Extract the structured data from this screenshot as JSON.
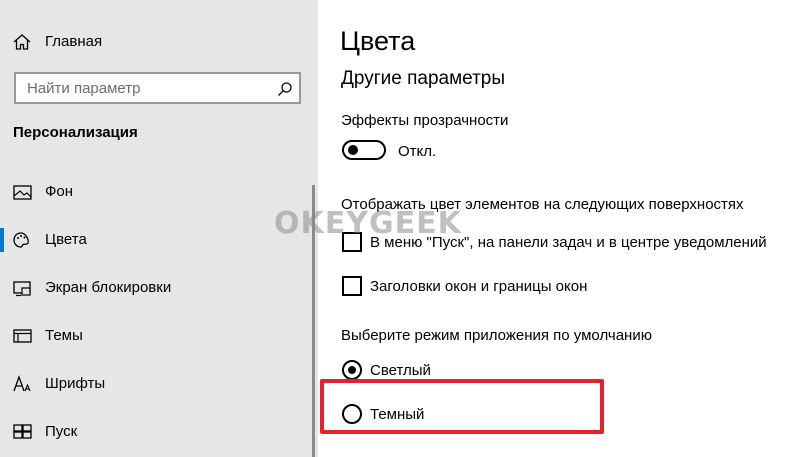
{
  "sidebar": {
    "home_label": "Главная",
    "search_placeholder": "Найти параметр",
    "section_title": "Персонализация",
    "items": [
      {
        "label": "Фон",
        "icon": "image-icon"
      },
      {
        "label": "Цвета",
        "icon": "palette-icon",
        "selected": true
      },
      {
        "label": "Экран блокировки",
        "icon": "lock-screen-icon"
      },
      {
        "label": "Темы",
        "icon": "themes-icon"
      },
      {
        "label": "Шрифты",
        "icon": "fonts-icon"
      },
      {
        "label": "Пуск",
        "icon": "start-icon"
      }
    ]
  },
  "main": {
    "title": "Цвета",
    "subtitle": "Другие параметры",
    "transparency": {
      "label": "Эффекты прозрачности",
      "state_label": "Откл.",
      "on": false
    },
    "surfaces": {
      "label": "Отображать цвет элементов на следующих поверхностях",
      "options": [
        {
          "label": "В меню \"Пуск\", на панели задач и в центре уведомлений",
          "checked": false
        },
        {
          "label": "Заголовки окон и границы окон",
          "checked": false
        }
      ]
    },
    "app_mode": {
      "label": "Выберите режим приложения по умолчанию",
      "options": [
        {
          "label": "Светлый",
          "selected": true
        },
        {
          "label": "Темный",
          "selected": false
        }
      ]
    }
  },
  "watermark": "OKEYGEEK",
  "colors": {
    "accent": "#0078d7",
    "highlight": "#e8202a",
    "sidebar_bg": "#e6e6e6"
  }
}
